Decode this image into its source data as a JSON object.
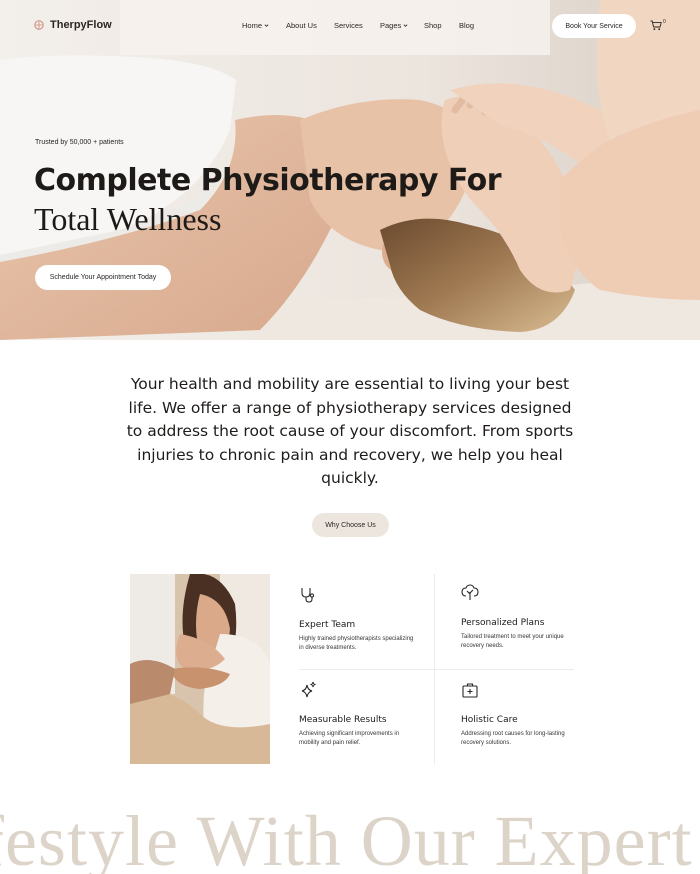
{
  "nav": {
    "logo": "TherpyFlow",
    "menu": [
      "Home",
      "About Us",
      "Services",
      "Pages",
      "Shop",
      "Blog"
    ],
    "cta": "Book Your Service",
    "cart_count": "0"
  },
  "hero": {
    "trusted": "Trusted by 50,000 + patients",
    "title_line1": "Complete Physiotherapy For",
    "title_line2": "Total Wellness",
    "button": "Schedule Your Appointment Today"
  },
  "intro": {
    "text": "Your health and mobility are essential to living your best life. We offer a range of physiotherapy services designed to address the root cause of your discomfort. From sports injuries to chronic pain and recovery, we help you heal quickly.",
    "button": "Why Choose Us"
  },
  "features": [
    {
      "icon": "stethoscope-icon",
      "title": "Expert Team",
      "desc": "Highly trained physiotherapists specializing in diverse treatments."
    },
    {
      "icon": "tree-icon",
      "title": "Personalized Plans",
      "desc": "Tailored treatment to meet your unique recovery needs."
    },
    {
      "icon": "sparkle-icon",
      "title": "Measurable Results",
      "desc": "Achieving significant improvements in mobility and pain relief."
    },
    {
      "icon": "first-aid-kit-icon",
      "title": "Holistic Care",
      "desc": "Addressing root causes for long-lasting recovery solutions."
    }
  ],
  "marquee": "festyle With Our Expert",
  "colors": {
    "accent_beige": "#ece6df",
    "marquee": "#ddd4c9",
    "text": "#1f1c1a"
  }
}
